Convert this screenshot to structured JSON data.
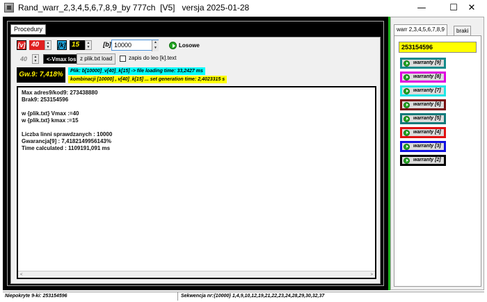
{
  "window": {
    "title": "Rand_warr_2,3,4,5,6,7,8,9_by 777ch  [V5]   versja 2025-01-28",
    "minimize": "—",
    "maximize": "☐",
    "close": "✕"
  },
  "tabs": {
    "main": "Procedury"
  },
  "controls": {
    "v_label": "[v]",
    "v_value": "40",
    "k_label": "[k]",
    "k_value": "15",
    "b_label": "[b]",
    "b_value": "10000",
    "losowe_label": "Losowe",
    "vmax_value": "40",
    "vmax_button": "<-Vmax los.",
    "plik_button": "z plik.txt load",
    "zapis_label": "zapis do leo [k].text"
  },
  "gw": "Gw.9: 7,418%",
  "info": {
    "plik_line": "Plik: b[10000]_v[40]_k[15]  -> file loading time: 33,2427 ms",
    "komb_line": "kombinacji [10000] , v[40]_k[15] ... set generation time: 2,4023315 s"
  },
  "output_lines": [
    "Max adres9/kod9: 273438880",
    "Brak9: 253154596",
    "",
    "w {plik.txt} Vmax :=40",
    "w {plik.txt} kmax :=15",
    "",
    "Liczba linni sprawdzanych : 10000",
    "Gwarancja[9] : 7,4182149956143%",
    "Time calculated : 1109191,091 ms"
  ],
  "scroll": {
    "left": "<",
    "right": ">"
  },
  "right_panel": {
    "tab_active": "warr 2,3,4,5,6,7,8,9",
    "tab_other": "braki",
    "value": "253154596",
    "buttons": [
      {
        "label": "warranty [9]",
        "color": "#148a8a"
      },
      {
        "label": "warranty [8]",
        "color": "#e000e0"
      },
      {
        "label": "warranty [7]",
        "color": "#1ee6e6"
      },
      {
        "label": "warranty [6]",
        "color": "#7a1010"
      },
      {
        "label": "warranty [5]",
        "color": "#117a7a"
      },
      {
        "label": "warranty [4]",
        "color": "#e01010"
      },
      {
        "label": "warranty [3]",
        "color": "#1010e0"
      },
      {
        "label": "warranty [2]",
        "color": "#000000"
      }
    ]
  },
  "status": {
    "left": "Niepokryte 9-ki: 253154596",
    "right": "Sekwencja nr:{10000}  1,4,9,10,12,19,21,22,23,24,28,29,30,32,37"
  },
  "colors": {
    "accent_green": "#1db31d",
    "gw_text": "#ffef00",
    "info_cyan": "#00ffff",
    "info_yellow": "#ffff00",
    "v_box": "#e02020",
    "k_box": "#1aa0d8"
  }
}
